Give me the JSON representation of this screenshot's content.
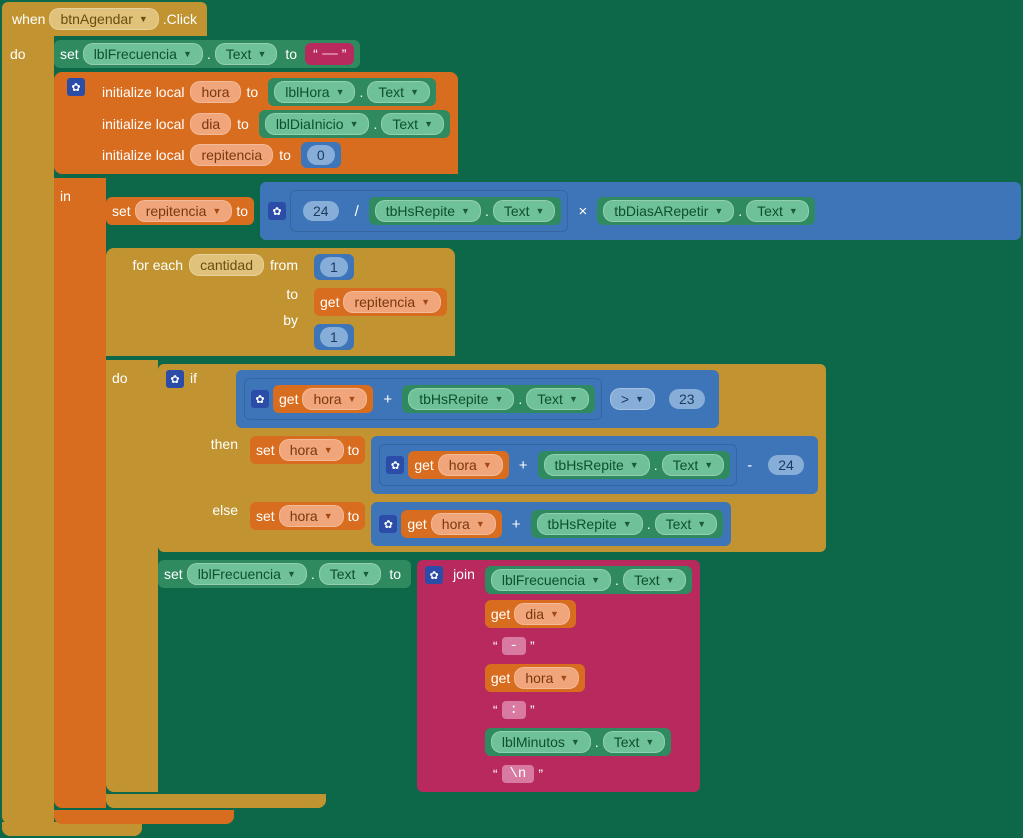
{
  "event": {
    "when": "when",
    "component": "btnAgendar",
    "suffix": ".Click"
  },
  "do": "do",
  "set": "set",
  "to": "to",
  "in": "in",
  "if": "if",
  "then": "then",
  "else": "else",
  "join": "join",
  "initLocal": "initialize local",
  "forEach": "for each",
  "from": "from",
  "by": "by",
  "get": "get",
  "dot": ".",
  "textProp": "Text",
  "lblFrecuencia": "lblFrecuencia",
  "lblHora": "lblHora",
  "lblDiaInicio": "lblDiaInicio",
  "lblMinutos": "lblMinutos",
  "tbHsRepite": "tbHsRepite",
  "tbDiasARepetir": "tbDiasARepetir",
  "vars": {
    "hora": "hora",
    "dia": "dia",
    "repitencia": "repitencia",
    "cantidad": "cantidad"
  },
  "nums": {
    "zero": "0",
    "one": "1",
    "one2": "1",
    "n24": "24",
    "n24b": "24",
    "n23": "23"
  },
  "ops": {
    "div": "/",
    "mul": "×",
    "plus": "+",
    "minus": "-",
    "gt": ">"
  },
  "strings": {
    "empty": " ",
    "dash": " - ",
    "colon": " : ",
    "newline": " \\n "
  },
  "quote1": "“",
  "quote2": "”"
}
